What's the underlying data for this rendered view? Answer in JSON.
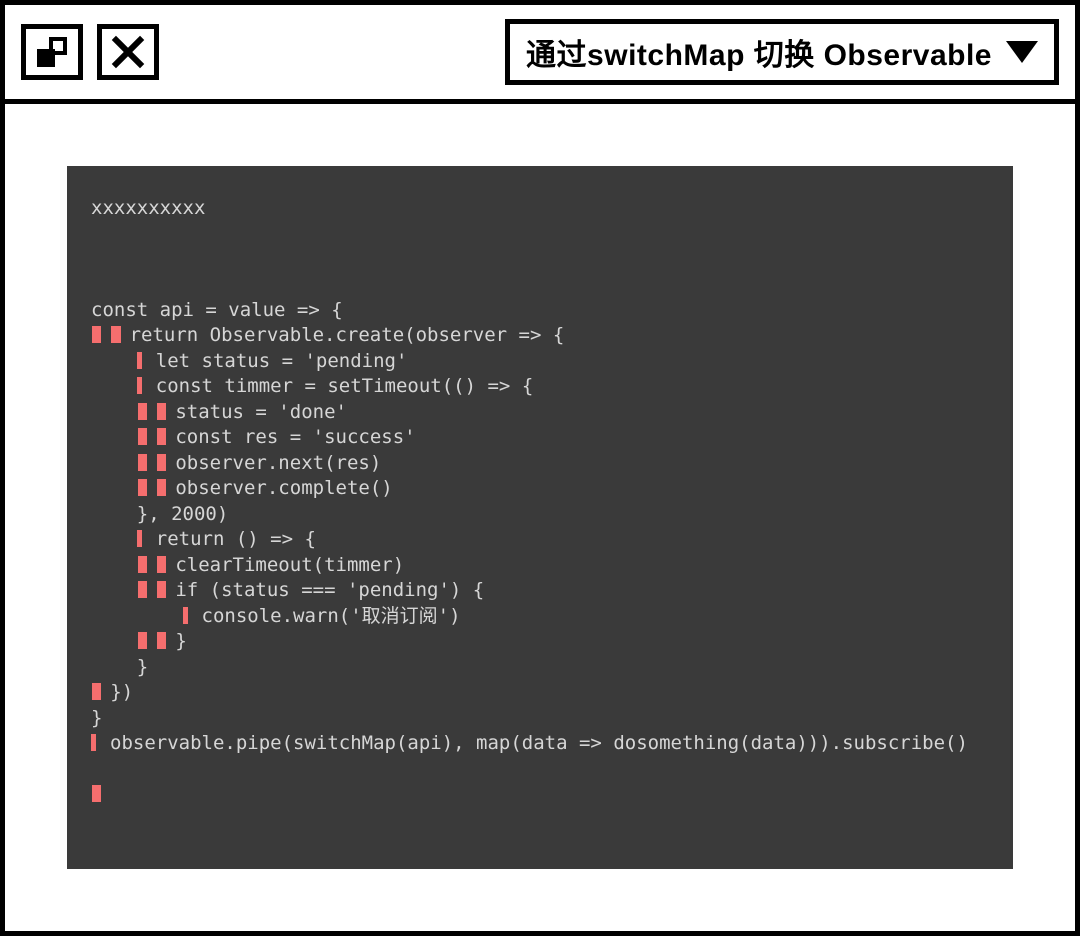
{
  "titlebar": {
    "title": "通过switchMap 切换 Observable"
  },
  "code": {
    "l0": "xxxxxxxxxx",
    "l1": "const api = value => {",
    "l2": "return Observable.create(observer => {",
    "l3": "let status = 'pending'",
    "l4": "const timmer = setTimeout(() => {",
    "l5": "status = 'done'",
    "l6": "const res = 'success'",
    "l7": "observer.next(res)",
    "l8": "observer.complete()",
    "l9": "    }, 2000)",
    "l10": "return () => {",
    "l11": "clearTimeout(timmer)",
    "l12": "if (status === 'pending') {",
    "l13": "console.warn('取消订阅')",
    "l14": "}",
    "l15": "    }",
    "l16": "})",
    "l17": "}",
    "l18": "observable.pipe(switchMap(api), map(data => dosomething(data))).subscribe()"
  }
}
